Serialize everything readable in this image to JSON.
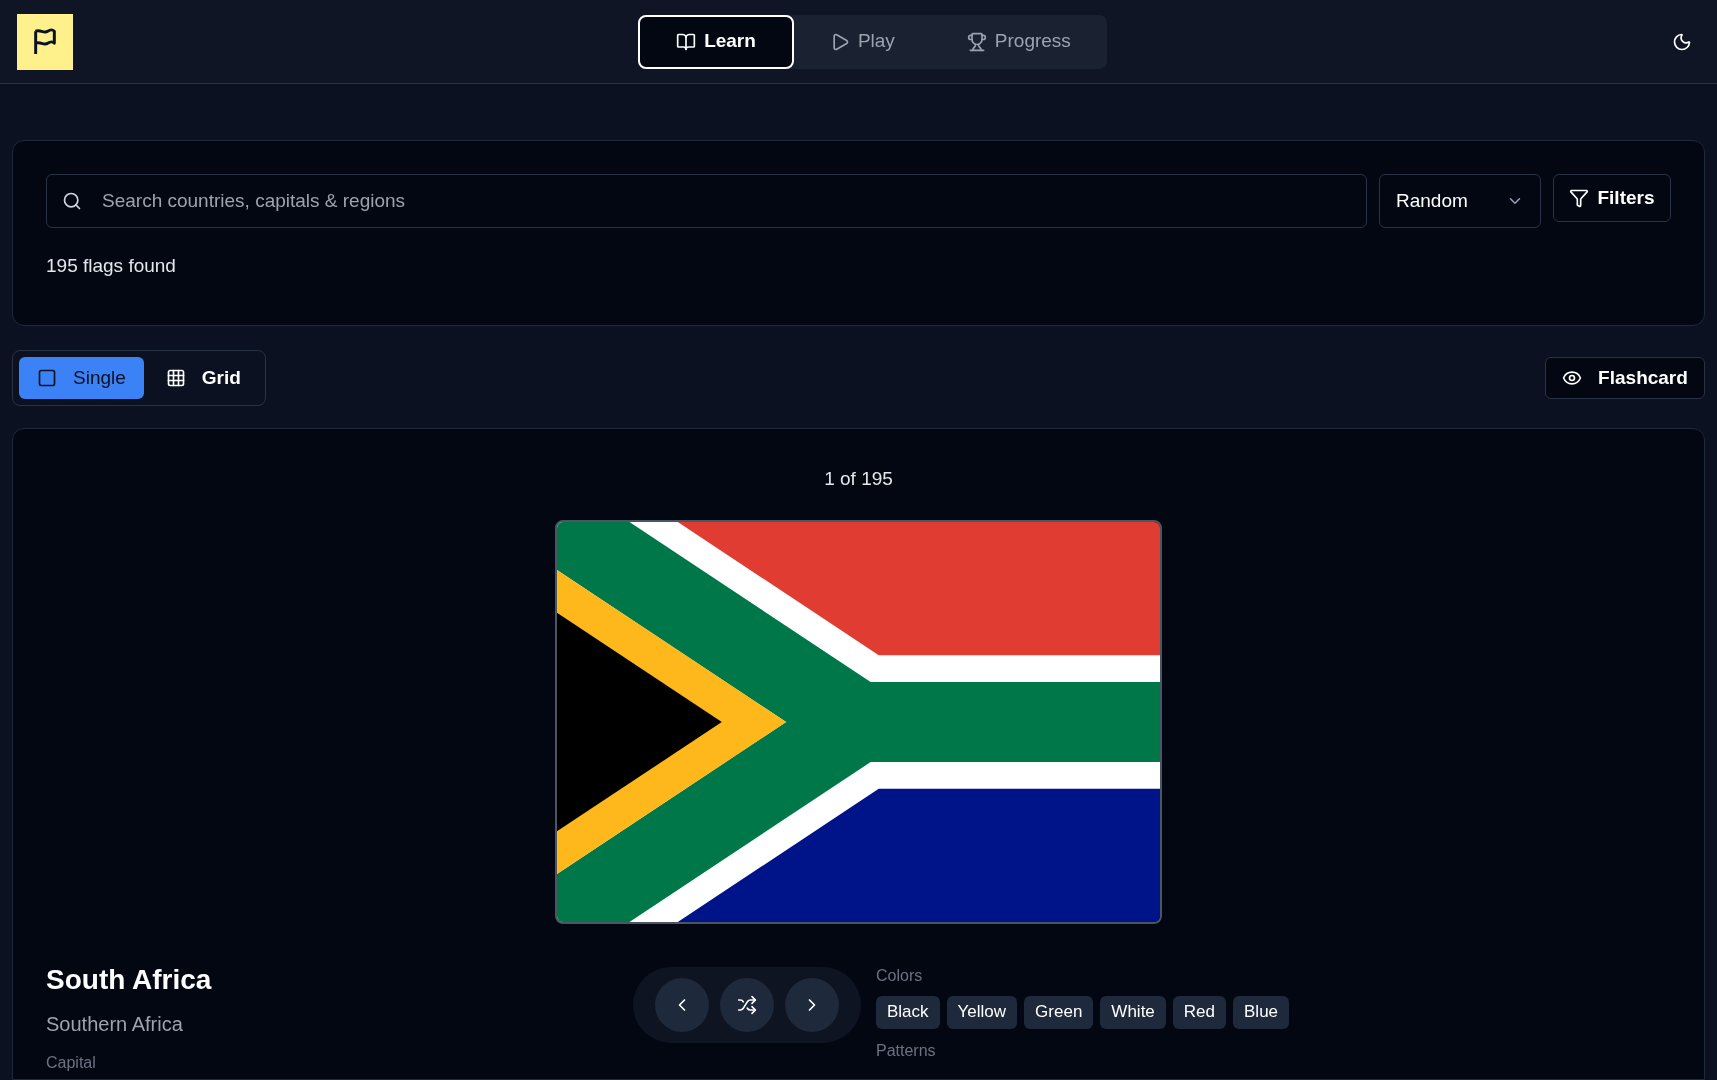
{
  "header": {
    "tabs": [
      {
        "label": "Learn",
        "selected": true
      },
      {
        "label": "Play",
        "selected": false
      },
      {
        "label": "Progress",
        "selected": false
      }
    ]
  },
  "search": {
    "placeholder": "Search countries, capitals & regions",
    "sort": "Random",
    "filters_button": "Filters",
    "result_count": "195 flags found"
  },
  "view_modes": [
    {
      "label": "Single",
      "selected": true
    },
    {
      "label": "Grid",
      "selected": false
    }
  ],
  "flashcard_button": "Flashcard",
  "card": {
    "position": "1 of 195",
    "country": "South Africa",
    "region": "Southern Africa",
    "capital_label": "Capital",
    "colors_label": "Colors",
    "colors": [
      "Black",
      "Yellow",
      "Green",
      "White",
      "Red",
      "Blue"
    ],
    "patterns_label": "Patterns"
  }
}
